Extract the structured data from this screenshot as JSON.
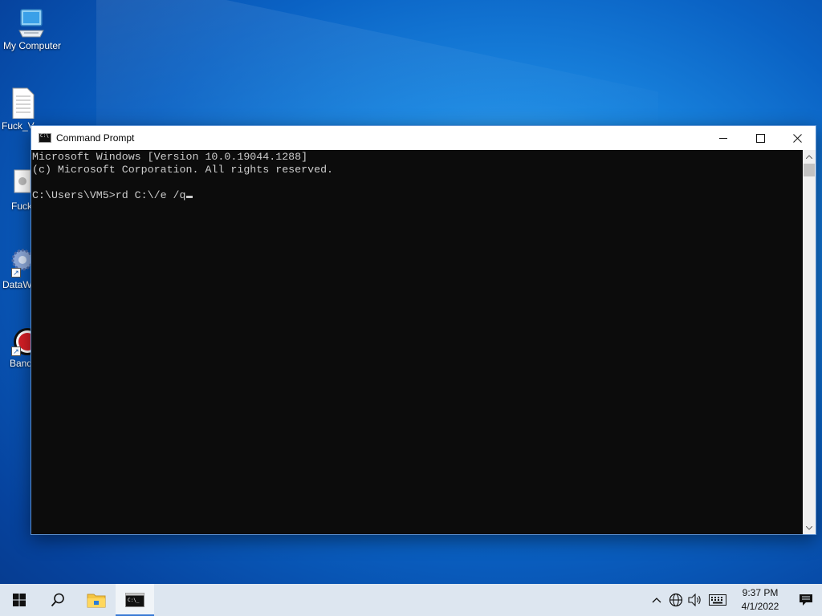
{
  "desktop": {
    "icons": [
      {
        "label": "My Computer",
        "icon": "computer-icon"
      },
      {
        "label": "Fuck_V",
        "icon": "text-file-icon"
      },
      {
        "label": "Fuck",
        "icon": "settings-file-icon"
      },
      {
        "label": "DataW",
        "icon": "gear-shortcut-icon"
      },
      {
        "label": "Band",
        "icon": "record-shortcut-icon"
      }
    ]
  },
  "cmd_window": {
    "title": "Command Prompt",
    "lines": [
      "Microsoft Windows [Version 10.0.19044.1288]",
      "(c) Microsoft Corporation. All rights reserved.",
      "",
      "C:\\Users\\VM5>rd C:\\/e /q"
    ],
    "controls": {
      "minimize": "minimize-icon",
      "maximize": "maximize-icon",
      "close": "close-icon"
    }
  },
  "taskbar": {
    "buttons": [
      {
        "name": "start",
        "icon": "windows-logo-icon"
      },
      {
        "name": "search",
        "icon": "search-icon"
      },
      {
        "name": "file-explorer",
        "icon": "folder-icon"
      },
      {
        "name": "command-prompt",
        "icon": "cmd-icon",
        "active": true
      }
    ],
    "tray": {
      "icons": [
        "chevron-up-icon",
        "network-icon",
        "volume-icon",
        "keyboard-icon"
      ],
      "time": "9:37 PM",
      "date": "4/1/2022"
    }
  },
  "colors": {
    "console_bg": "#0c0c0c",
    "console_text": "#cccccc",
    "taskbar_bg": "#dde6f0",
    "accent": "#3a7bd5"
  }
}
